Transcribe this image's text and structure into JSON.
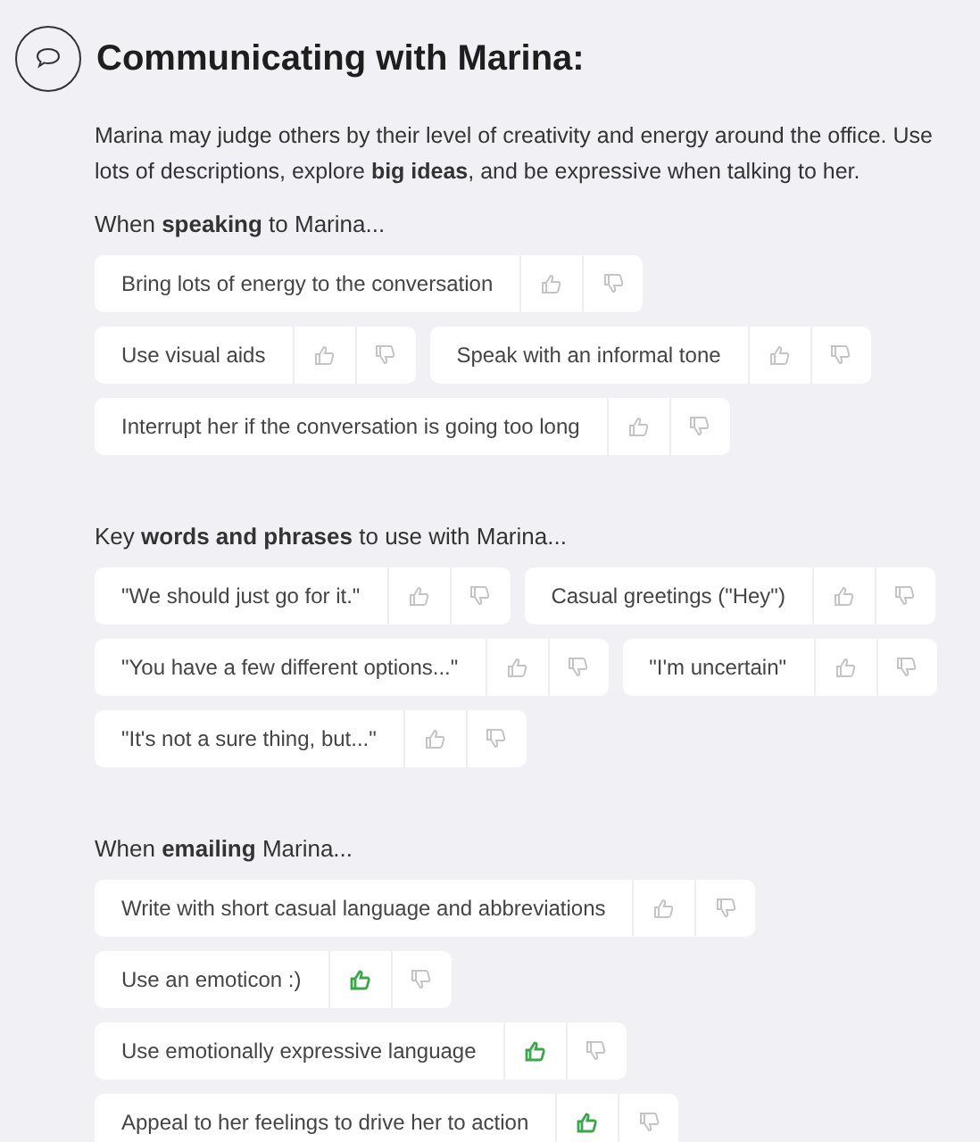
{
  "title": "Communicating with Marina:",
  "intro": "Marina may judge others by their level of creativity and energy around the office. Use lots of descriptions, explore **big ideas**, and be expressive when talking to her.",
  "sections": [
    {
      "heading": "When **speaking** to Marina...",
      "items": [
        {
          "text": "Bring lots of energy to the conversation",
          "liked": false
        },
        {
          "text": "Use visual aids",
          "liked": false
        },
        {
          "text": "Speak with an informal tone",
          "liked": false
        },
        {
          "text": "Interrupt her if the conversation is going too long",
          "liked": false
        }
      ]
    },
    {
      "heading": "Key **words and phrases** to use with Marina...",
      "items": [
        {
          "text": "\"We should just go for it.\"",
          "liked": false
        },
        {
          "text": "Casual greetings (\"Hey\")",
          "liked": false
        },
        {
          "text": "\"You have a few different options...\"",
          "liked": false
        },
        {
          "text": "\"I'm uncertain\"",
          "liked": false
        },
        {
          "text": "\"It's not a sure thing, but...\"",
          "liked": false
        }
      ]
    },
    {
      "heading": "When **emailing** Marina...",
      "items": [
        {
          "text": "Write with short casual language and abbreviations",
          "liked": false
        },
        {
          "text": "Use an emoticon :)",
          "liked": true
        },
        {
          "text": "Use emotionally expressive language",
          "liked": true
        },
        {
          "text": "Appeal to her feelings to drive her to action",
          "liked": true
        }
      ]
    }
  ]
}
